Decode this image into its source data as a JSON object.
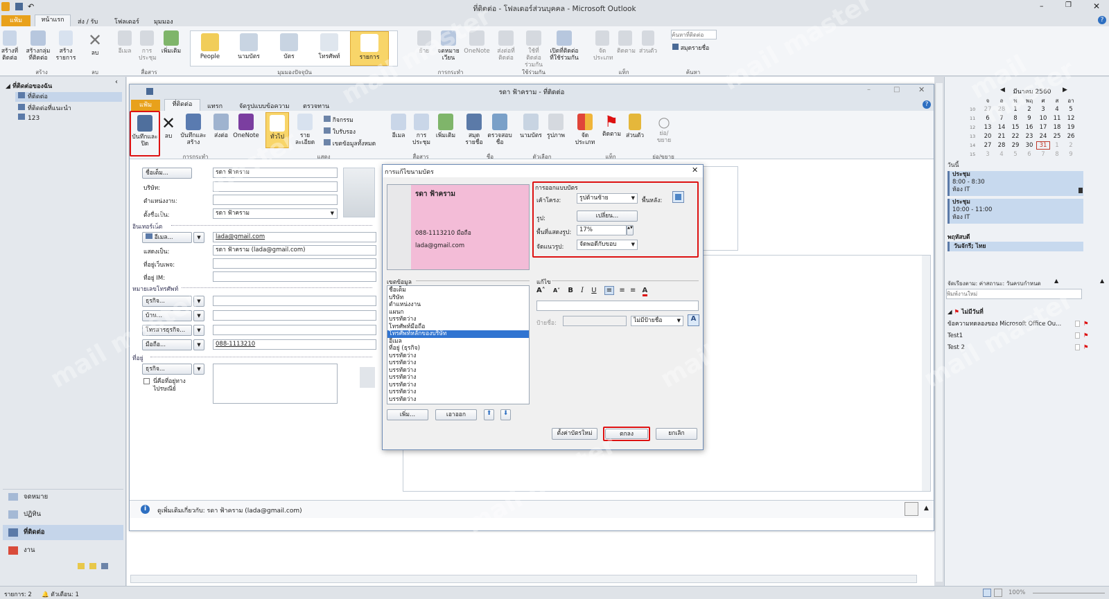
{
  "app": {
    "title": "ที่ติดต่อ - โฟลเดอร์ส่วนบุคคล - Microsoft Outlook"
  },
  "main_tabs": [
    "แฟ้ม",
    "หน้าแรก",
    "ส่ง / รับ",
    "โฟลเดอร์",
    "มุมมอง"
  ],
  "main_ribbon": {
    "new_group": [
      "สร้างที่ติดต่อ",
      "สร้างกลุ่มที่ติดต่อ",
      "สร้างรายการ"
    ],
    "new_label": "สร้าง",
    "delete": "ลบ",
    "delete_group": "ลบ",
    "comm": [
      "อีเมล",
      "การประชุม",
      "เพิ่มเติม"
    ],
    "comm_group": "สื่อสาร",
    "views": [
      "People",
      "นามบัตร",
      "บัตร",
      "โทรศัพท์",
      "รายการ"
    ],
    "views_group": "มุมมองปัจจุบัน",
    "actions": [
      "ย้าย",
      "จดหมายเวียน",
      "OneNote"
    ],
    "actions_group": "การกระทำ",
    "share": [
      "ส่งต่อที่ติดต่อ",
      "ใช้ที่ติดต่อร่วมกัน",
      "เปิดที่ติดต่อที่ใช้ร่วมกัน"
    ],
    "share_group": "ใช้ร่วมกัน",
    "tags": [
      "จัดประเภท",
      "ติดตาม",
      "ส่วนตัว"
    ],
    "tags_group": "แท็ก",
    "find_placeholder": "ค้นหาที่ติดต่อ",
    "address_book": "สมุดรายชื่อ",
    "find_group": "ค้นหา"
  },
  "nav": {
    "header": "ที่ติดต่อของฉัน",
    "items": [
      "ที่ติดต่อ",
      "ที่ติดต่อที่แนะนำ",
      "123"
    ],
    "bottom": [
      "จดหมาย",
      "ปฏิทิน",
      "ที่ติดต่อ",
      "งาน"
    ]
  },
  "contact_window": {
    "title": "รดา ฟ้าคราม - ที่ติดต่อ",
    "tabs": [
      "แฟ้ม",
      "ที่ติดต่อ",
      "แทรก",
      "จัดรูปแบบข้อความ",
      "ตรวจทาน"
    ],
    "ribbon": {
      "save_close": "บันทึกและปิด",
      "delete": "ลบ",
      "save_new": "บันทึกและสร้าง",
      "send": "ส่งต่อ",
      "onenote": "OneNote",
      "actions_group": "การกระทำ",
      "general": "ทั่วไป",
      "details": "รายละเอียด",
      "activities": "กิจกรรม",
      "certs": "ใบรับรอง",
      "all_fields": "เขตข้อมูลทั้งหมด",
      "show_group": "แสดง",
      "email": "อีเมล",
      "meeting": "การประชุม",
      "more": "เพิ่มเติม",
      "comm_group": "สื่อสาร",
      "addr_book": "สมุดรายชื่อ",
      "check_names": "ตรวจสอบชื่อ",
      "names_group": "ชื่อ",
      "business_card": "นามบัตร",
      "picture": "รูปภาพ",
      "options_group": "ตัวเลือก",
      "categorize": "จัดประเภท",
      "follow": "ติดตาม",
      "private": "ส่วนตัว",
      "tags_group": "แท็ก",
      "zoom": "ย่อ/ขยาย",
      "zoom_group": "ย่อ/ขยาย"
    },
    "form": {
      "full_name_btn": "ชื่อเต็ม...",
      "full_name": "รดา ฟ้าคราม",
      "company_lbl": "บริษัท:",
      "job_lbl": "ตำแหน่งงาน:",
      "file_as_lbl": "ตั้งชื่อเป็น:",
      "file_as": "รดา ฟ้าคราม",
      "internet_lbl": "อินเทอร์เน็ต",
      "email_btn": "อีเมล...",
      "email": "lada@gmail.com",
      "display_lbl": "แสดงเป็น:",
      "display": "รดา ฟ้าคราม (lada@gmail.com)",
      "web_lbl": "ที่อยู่เว็บเพจ:",
      "im_lbl": "ที่อยู่ IM:",
      "phone_lbl": "หมายเลขโทรศัพท์",
      "phones": [
        {
          "btn": "ธุรกิจ...",
          "val": ""
        },
        {
          "btn": "บ้าน...",
          "val": ""
        },
        {
          "btn": "โทรสารธุรกิจ...",
          "val": ""
        },
        {
          "btn": "มือถือ...",
          "val": "088-1113210"
        }
      ],
      "address_lbl": "ที่อยู่",
      "address_btn": "ธุรกิจ...",
      "mailing_chk": "นี่คือที่อยู่ทางไปรษณีย์"
    },
    "footer": "ดูเพิ่มเติมเกี่ยวกับ: รดา ฟ้าคราม (lada@gmail.com)"
  },
  "dialog": {
    "title": "การแก้ไขนามบัตร",
    "card": {
      "name": "รดา ฟ้าคราม",
      "phone": "088-1113210 มือถือ",
      "email": "lada@gmail.com"
    },
    "design_lbl": "การออกแบบบัตร",
    "layout_lbl": "เค้าโครง:",
    "layout_val": "รูปด้านซ้าย",
    "bg_lbl": "พื้นหลัง:",
    "image_lbl": "รูป:",
    "change_btn": "เปลี่ยน...",
    "area_lbl": "พื้นที่แสดงรูป:",
    "area_val": "17%",
    "align_lbl": "จัดแนวรูป:",
    "align_val": "จัดพอดีกับขอบ",
    "fields_lbl": "เขตข้อมูล",
    "fields": [
      "ชื่อเต็ม",
      "บริษัท",
      "ตำแหน่งงาน",
      "แผนก",
      "  บรรทัดว่าง",
      "โทรศัพท์มือถือ",
      "โทรศัพท์หลักของบริษัท",
      "อีเมล",
      "ที่อยู่ (ธุรกิจ)",
      "  บรรทัดว่าง",
      "  บรรทัดว่าง",
      "  บรรทัดว่าง",
      "  บรรทัดว่าง",
      "  บรรทัดว่าง",
      "  บรรทัดว่าง",
      "  บรรทัดว่าง"
    ],
    "selected_field": 6,
    "add_btn": "เพิ่ม...",
    "remove_btn": "เอาออก",
    "edit_lbl": "แก้ไข",
    "label_lbl": "ป้ายชื่อ:",
    "label_pos": "ไม่มีป้ายชื่อ",
    "reset_btn": "ตั้งค่าบัตรใหม่",
    "ok_btn": "ตกลง",
    "cancel_btn": "ยกเลิก"
  },
  "todo": {
    "month": "มีนาคม 2560",
    "weekdays": [
      "จ",
      "อ",
      "พ",
      "พฤ",
      "ศ",
      "ส",
      "อา"
    ],
    "weeks": [
      [
        "10",
        "27",
        "28",
        "1",
        "2",
        "3",
        "4",
        "5"
      ],
      [
        "11",
        "6",
        "7",
        "8",
        "9",
        "10",
        "11",
        "12"
      ],
      [
        "12",
        "13",
        "14",
        "15",
        "16",
        "17",
        "18",
        "19"
      ],
      [
        "13",
        "20",
        "21",
        "22",
        "23",
        "24",
        "25",
        "26"
      ],
      [
        "14",
        "27",
        "28",
        "29",
        "30",
        "31",
        "1",
        "2"
      ],
      [
        "15",
        "3",
        "4",
        "5",
        "6",
        "7",
        "8",
        "9"
      ]
    ],
    "today_lbl": "วันนี้",
    "appt_hdr": "วันนี้",
    "appts": [
      {
        "title": "ประชุม",
        "time": "8:00 - 8:30",
        "loc": "ห้อง IT"
      },
      {
        "title": "ประชุม",
        "time": "10:00 - 11:00",
        "loc": "ห้อง IT"
      }
    ],
    "thu_lbl": "พฤหัสบดี",
    "thu_item": "วันจักรี; ไทย",
    "sort_lbl": "จัดเรียงตาม: ค่าสถานะ: วันครบกำหนด",
    "new_task": "พิมพ์งานใหม่",
    "no_date": "ไม่มีวันที่",
    "tasks": [
      "ข้อความทดลองของ Microsoft Office Ou...",
      "Test1",
      "Test 2"
    ]
  },
  "status": {
    "items": "รายการ: 2",
    "reminders": "ตัวเตือน: 1",
    "zoom": "100%"
  },
  "watermark": "mail master"
}
